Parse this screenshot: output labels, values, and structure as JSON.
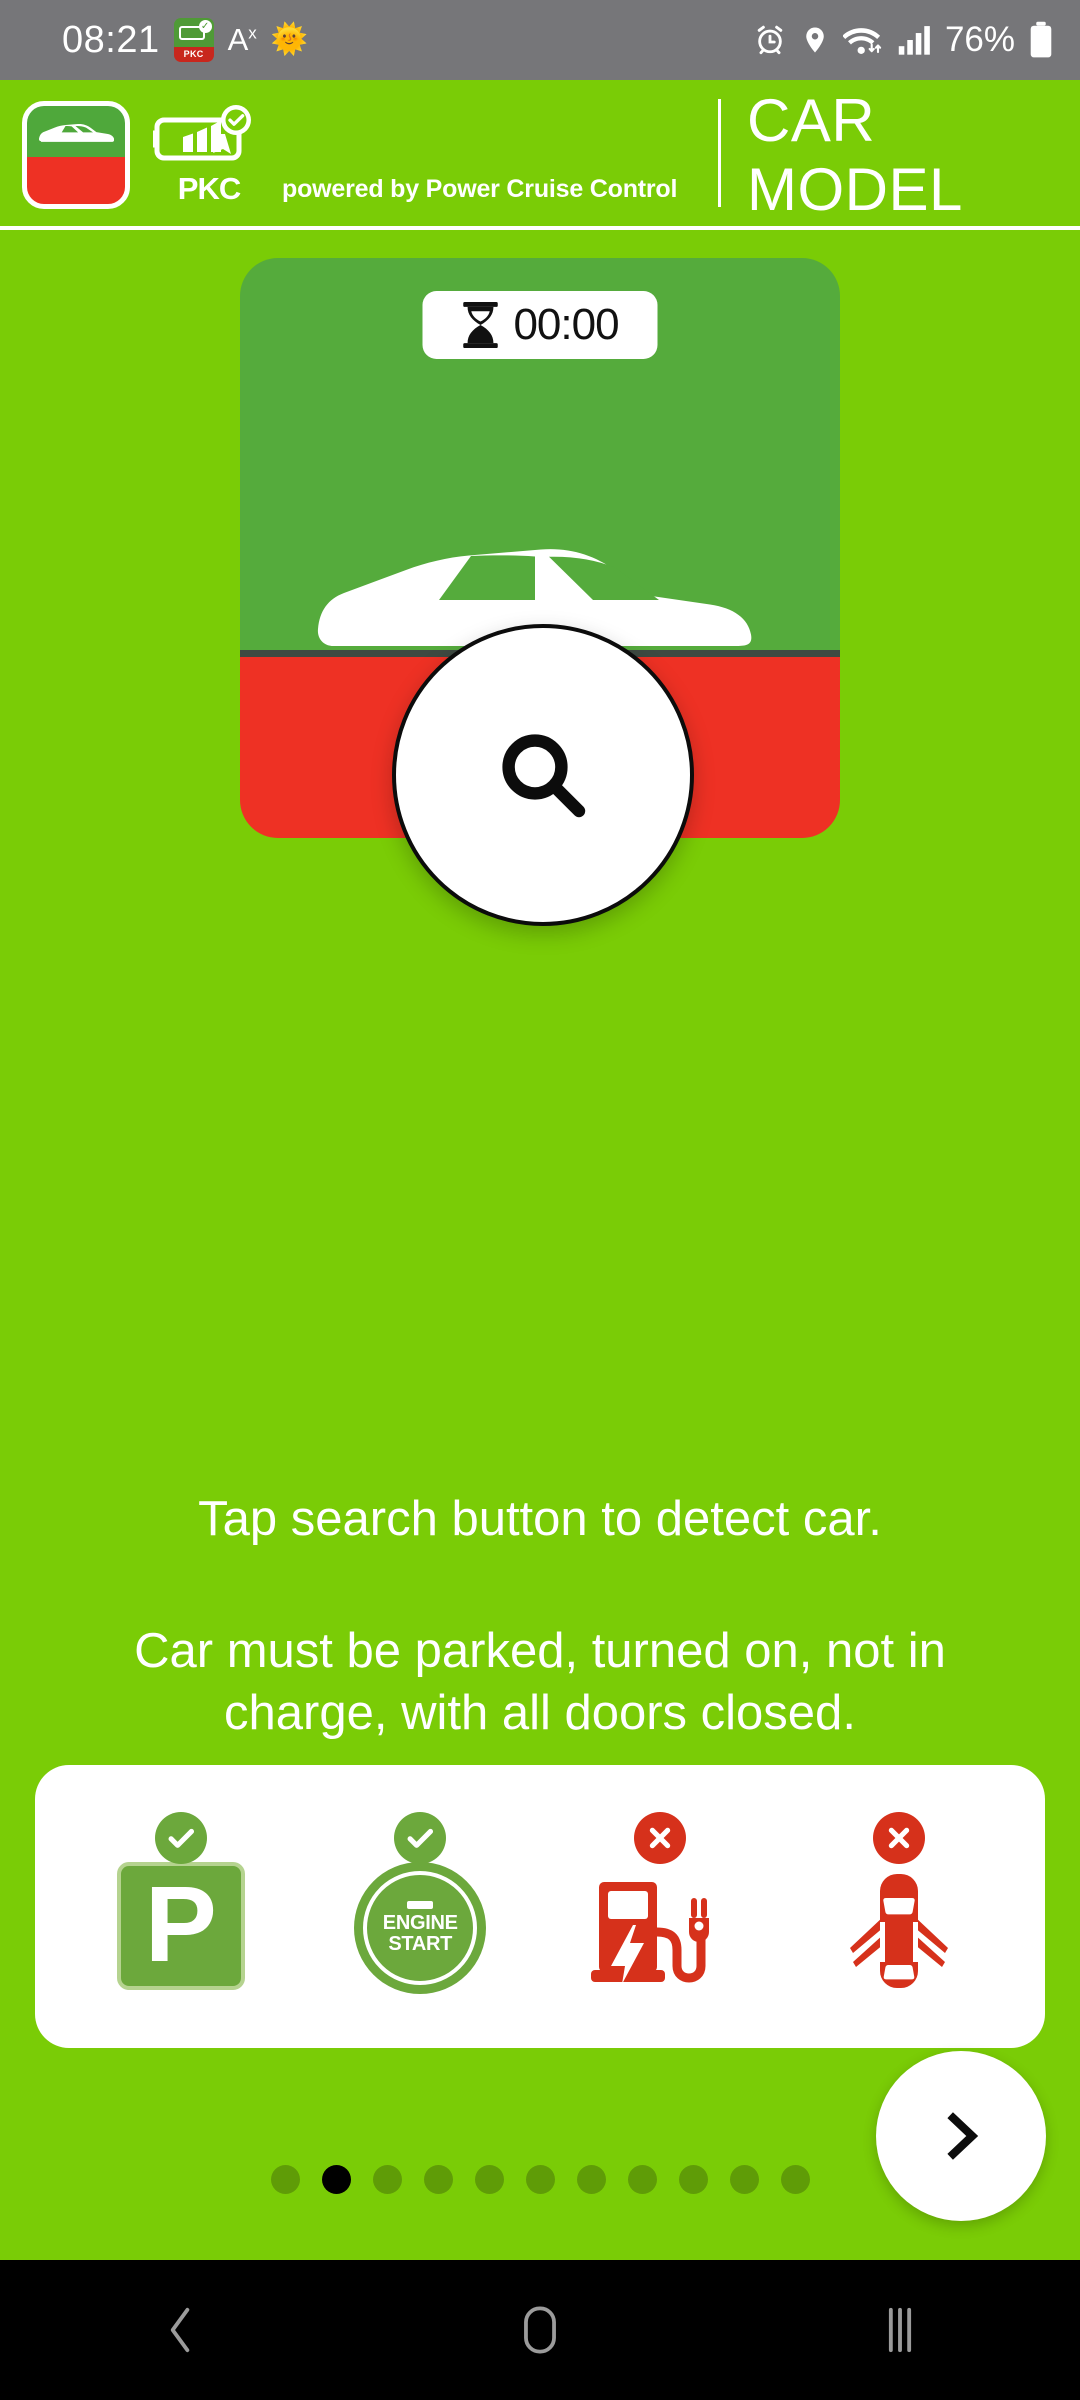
{
  "status_bar": {
    "time": "08:21",
    "pkc_tray_label": "PKC",
    "text_size_icon": "A",
    "text_size_sup": "x",
    "sun_emoji": "🌞",
    "battery_percent": "76%",
    "icons": [
      "alarm-icon",
      "location-pin-icon",
      "wifi-icon",
      "signal-bars-icon",
      "battery-icon"
    ],
    "background": "#767679"
  },
  "header": {
    "app_icon_name": "app-icon-car",
    "logo_text": "PKC",
    "powered_by": "powered by Power Cruise Control",
    "title": "CAR MODEL",
    "background": "#7ACC06"
  },
  "car_card": {
    "timer_icon": "hourglass-icon",
    "timer_value": "00:00",
    "top_color": "#55AB3C",
    "bottom_color": "#EE3124",
    "car_icon": "car-side-silhouette"
  },
  "search_button": {
    "icon": "search-magnifier-icon",
    "label": ""
  },
  "instructions": {
    "primary": "Tap search button to detect car.",
    "secondary": "Car must be parked, turned on, not in charge, with all doors closed."
  },
  "conditions": [
    {
      "name": "parking",
      "badge": "check",
      "badge_color": "#6CA83C",
      "glyph": "parking-sign-icon",
      "letter": "P"
    },
    {
      "name": "engine-start",
      "badge": "check",
      "badge_color": "#6CA83C",
      "glyph": "engine-start-button-icon",
      "line1": "ENGINE",
      "line2": "START"
    },
    {
      "name": "not-charging",
      "badge": "cross",
      "badge_color": "#D6311B",
      "glyph": "ev-charger-plug-icon"
    },
    {
      "name": "doors-closed",
      "badge": "cross",
      "badge_color": "#D6311B",
      "glyph": "car-doors-open-icon"
    }
  ],
  "next_button": {
    "icon": "chevron-right-icon"
  },
  "pagination": {
    "total": 11,
    "active_index": 1
  },
  "nav_bar": {
    "back": "back-chevron-icon",
    "home": "home-icon",
    "recents": "recents-icon"
  },
  "colors": {
    "brand_green": "#7ACC06",
    "card_green": "#55AB3C",
    "card_red": "#EE3124",
    "ok_green": "#6CA83C",
    "no_red": "#D6311B"
  }
}
